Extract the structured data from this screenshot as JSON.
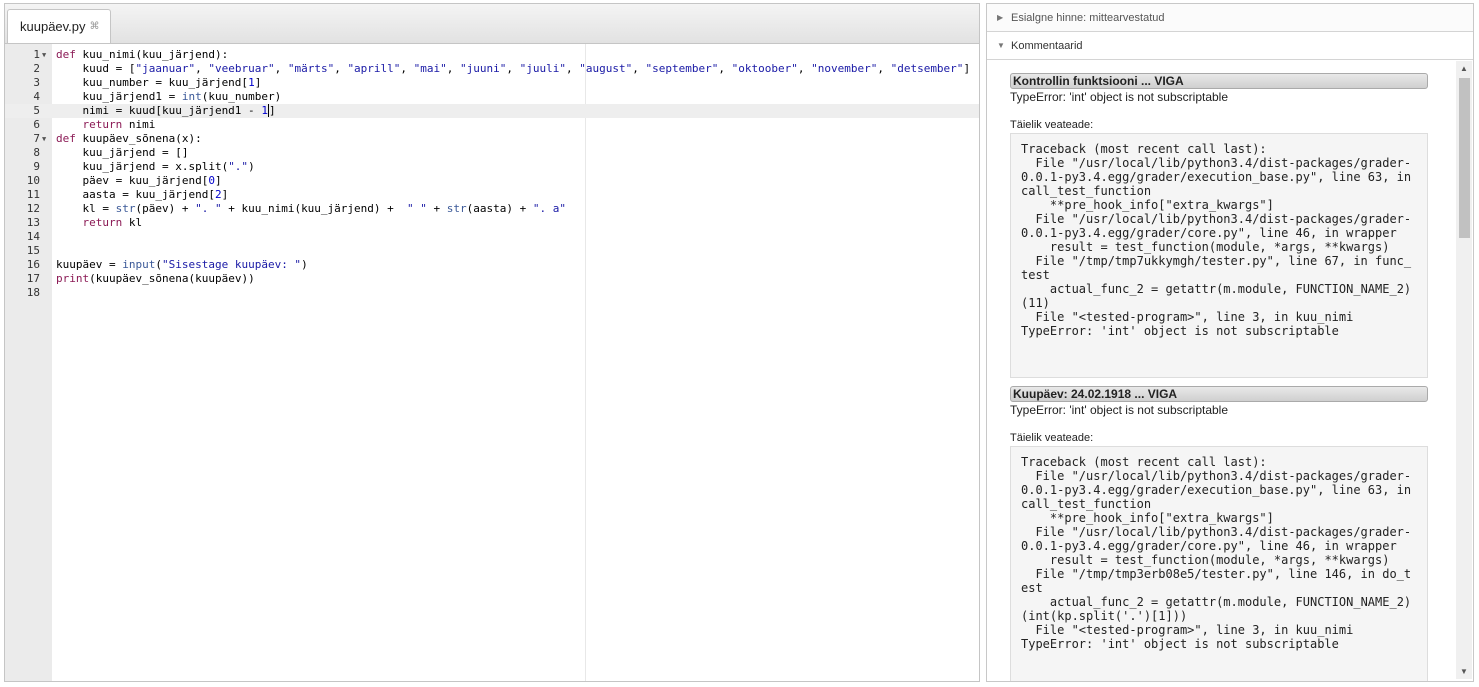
{
  "editor": {
    "tab_label": "kuupäev.py",
    "tab_close": "⌘",
    "lines": [
      {
        "n": "1",
        "fold": "▼",
        "html": "<span class='kw'>def</span> kuu_nimi(kuu_järjend):"
      },
      {
        "n": "2",
        "html": "    kuud = [<span class='str'>\"jaanuar\"</span>, <span class='str'>\"veebruar\"</span>, <span class='str'>\"märts\"</span>, <span class='str'>\"aprill\"</span>, <span class='str'>\"mai\"</span>, <span class='str'>\"juuni\"</span>, <span class='str'>\"juuli\"</span>, <span class='str'>\"august\"</span>, <span class='str'>\"september\"</span>, <span class='str'>\"oktoober\"</span>, <span class='str'>\"november\"</span>, <span class='str'>\"detsember\"</span>]"
      },
      {
        "n": "3",
        "html": "    kuu_number = kuu_järjend[<span class='num'>1</span>]"
      },
      {
        "n": "4",
        "html": "    kuu_järjend1 = <span class='fn'>int</span>(kuu_number)"
      },
      {
        "n": "5",
        "active": true,
        "html": "    nimi = kuud[kuu_järjend1 - <span class='num'>1</span><span class='cursor'>]</span>"
      },
      {
        "n": "6",
        "html": "    <span class='kw'>return</span> nimi"
      },
      {
        "n": "7",
        "fold": "▼",
        "html": "<span class='kw'>def</span> kuupäev_sõnena(x):"
      },
      {
        "n": "8",
        "html": "    kuu_järjend = []"
      },
      {
        "n": "9",
        "html": "    kuu_järjend = x.split(<span class='str'>\".\"</span>)"
      },
      {
        "n": "10",
        "html": "    päev = kuu_järjend[<span class='num'>0</span>]"
      },
      {
        "n": "11",
        "html": "    aasta = kuu_järjend[<span class='num'>2</span>]"
      },
      {
        "n": "12",
        "html": "    kl = <span class='fn'>str</span>(päev) + <span class='str'>\". \"</span> + kuu_nimi(kuu_järjend) +  <span class='str'>\" \"</span> + <span class='fn'>str</span>(aasta) + <span class='str'>\". a\"</span>"
      },
      {
        "n": "13",
        "html": "    <span class='kw'>return</span> kl"
      },
      {
        "n": "14",
        "html": ""
      },
      {
        "n": "15",
        "html": ""
      },
      {
        "n": "16",
        "html": "kuupäev = <span class='fn'>input</span>(<span class='str'>\"Sisestage kuupäev: \"</span>)"
      },
      {
        "n": "17",
        "html": "<span class='kw'>print</span>(kuupäev_sõnena(kuupäev))"
      },
      {
        "n": "18",
        "html": ""
      }
    ]
  },
  "panel": {
    "grade_header": "Esialgne hinne: mittearvestatud",
    "comments_header": "Kommentaarid",
    "tests": [
      {
        "title": "Kontrollin funktsiooni ... VIGA",
        "error": "TypeError: 'int' object is not subscriptable",
        "full_label": "Täielik veateade:",
        "traceback": "Traceback (most recent call last):\n  File \"/usr/local/lib/python3.4/dist-packages/grader-0.0.1-py3.4.egg/grader/execution_base.py\", line 63, in call_test_function\n    **pre_hook_info[\"extra_kwargs\"]\n  File \"/usr/local/lib/python3.4/dist-packages/grader-0.0.1-py3.4.egg/grader/core.py\", line 46, in wrapper\n    result = test_function(module, *args, **kwargs)\n  File \"/tmp/tmp7ukkymgh/tester.py\", line 67, in func_test\n    actual_func_2 = getattr(m.module, FUNCTION_NAME_2)(11)\n  File \"<tested-program>\", line 3, in kuu_nimi\nTypeError: 'int' object is not subscriptable"
      },
      {
        "title": "Kuupäev: 24.02.1918 ... VIGA",
        "error": "TypeError: 'int' object is not subscriptable",
        "full_label": "Täielik veateade:",
        "traceback": "Traceback (most recent call last):\n  File \"/usr/local/lib/python3.4/dist-packages/grader-0.0.1-py3.4.egg/grader/execution_base.py\", line 63, in call_test_function\n    **pre_hook_info[\"extra_kwargs\"]\n  File \"/usr/local/lib/python3.4/dist-packages/grader-0.0.1-py3.4.egg/grader/core.py\", line 46, in wrapper\n    result = test_function(module, *args, **kwargs)\n  File \"/tmp/tmp3erb08e5/tester.py\", line 146, in do_test\n    actual_func_2 = getattr(m.module, FUNCTION_NAME_2)(int(kp.split('.')[1]))\n  File \"<tested-program>\", line 3, in kuu_nimi\nTypeError: 'int' object is not subscriptable"
      }
    ]
  }
}
